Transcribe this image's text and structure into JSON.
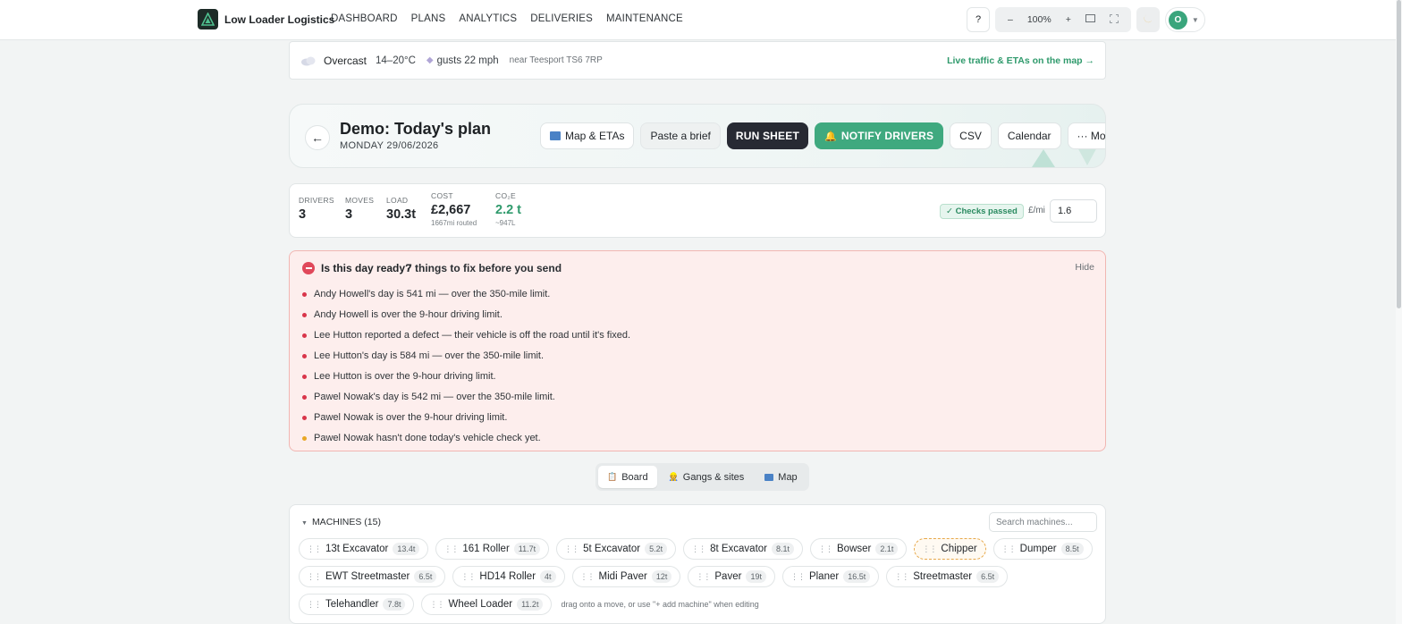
{
  "app": {
    "name": "Low Loader Logistics"
  },
  "nav": [
    {
      "label": "DASHBOARD"
    },
    {
      "label": "PLANS"
    },
    {
      "label": "ANALYTICS"
    },
    {
      "label": "DELIVERIES"
    },
    {
      "label": "MAINTENANCE"
    }
  ],
  "tools": {
    "help": "?",
    "zoom_out": "–",
    "zoom": "100%",
    "zoom_in": "+",
    "avatar": "O"
  },
  "weather": {
    "condition": "Overcast",
    "temp": "14–20°C",
    "wind": "gusts 22 mph",
    "location": "near Teesport TS6 7RP",
    "link": "Live traffic & ETAs on the map →"
  },
  "plan": {
    "title": "Demo: Today's plan",
    "date": "MONDAY 29/06/2026",
    "back": "←",
    "actions": {
      "map": "Map & ETAs",
      "paste": "Paste a brief",
      "run": "RUN SHEET",
      "notify": "NOTIFY DRIVERS",
      "csv": "CSV",
      "calendar": "Calendar",
      "more": "··· More"
    }
  },
  "stats": {
    "drivers": {
      "label": "DRIVERS",
      "value": "3"
    },
    "moves": {
      "label": "MOVES",
      "value": "3"
    },
    "load": {
      "label": "LOAD",
      "value": "30.3t"
    },
    "cost": {
      "label": "COST",
      "value": "£2,667",
      "sub": "1667mi routed"
    },
    "co2": {
      "label": "CO₂E",
      "value": "2.2 t",
      "sub": "~947L"
    },
    "checks": "✓ Checks passed",
    "per_mile_label": "£/mi",
    "per_mile_value": "1.6"
  },
  "alert": {
    "title": "Is this day ready?",
    "subtitle": "7 things to fix before you send",
    "hide": "Hide",
    "items": [
      {
        "text": "Andy Howell's day is 541 mi — over the 350-mile limit.",
        "level": "error"
      },
      {
        "text": "Andy Howell is over the 9-hour driving limit.",
        "level": "error"
      },
      {
        "text": "Lee Hutton reported a defect — their vehicle is off the road until it's fixed.",
        "level": "error"
      },
      {
        "text": "Lee Hutton's day is 584 mi — over the 350-mile limit.",
        "level": "error"
      },
      {
        "text": "Lee Hutton is over the 9-hour driving limit.",
        "level": "error"
      },
      {
        "text": "Pawel Nowak's day is 542 mi — over the 350-mile limit.",
        "level": "error"
      },
      {
        "text": "Pawel Nowak is over the 9-hour driving limit.",
        "level": "error"
      },
      {
        "text": "Pawel Nowak hasn't done today's vehicle check yet.",
        "level": "warning"
      }
    ]
  },
  "tabs": [
    {
      "label": "Board",
      "active": true
    },
    {
      "label": "Gangs & sites",
      "active": false
    },
    {
      "label": "Map",
      "active": false
    }
  ],
  "machines": {
    "header": "MACHINES (15)",
    "search_placeholder": "Search machines...",
    "hint": "drag onto a move, or use \"+ add machine\" when editing",
    "items": [
      {
        "name": "13t Excavator",
        "weight": "13.4t"
      },
      {
        "name": "161 Roller",
        "weight": "11.7t"
      },
      {
        "name": "5t Excavator",
        "weight": "5.2t"
      },
      {
        "name": "8t Excavator",
        "weight": "8.1t"
      },
      {
        "name": "Bowser",
        "weight": "2.1t"
      },
      {
        "name": "Chipper",
        "weight": ""
      },
      {
        "name": "Dumper",
        "weight": "8.5t"
      },
      {
        "name": "EWT Streetmaster",
        "weight": "6.5t"
      },
      {
        "name": "HD14 Roller",
        "weight": "4t"
      },
      {
        "name": "Midi Paver",
        "weight": "12t"
      },
      {
        "name": "Paver",
        "weight": "19t"
      },
      {
        "name": "Planer",
        "weight": "16.5t"
      },
      {
        "name": "Streetmaster",
        "weight": "6.5t"
      },
      {
        "name": "Telehandler",
        "weight": "7.8t"
      },
      {
        "name": "Wheel Loader",
        "weight": "11.2t"
      }
    ]
  },
  "colors": {
    "accent": "#3fa97f",
    "dark_button": "#272a33",
    "alert_bg": "#fdeeed",
    "error": "#d9354a",
    "warning": "#e9a825"
  }
}
